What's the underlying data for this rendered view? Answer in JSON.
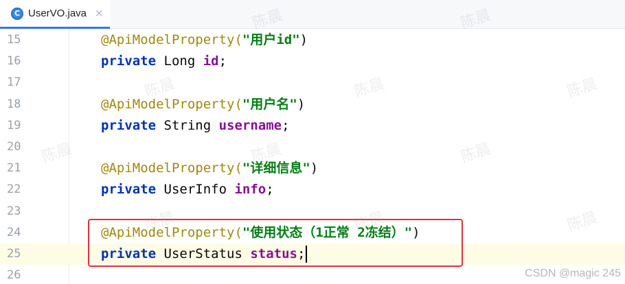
{
  "tab": {
    "icon_letter": "C",
    "icon": "java-class-icon",
    "filename": "UserVO.java",
    "close_glyph": "×"
  },
  "lines": [
    {
      "number": "15",
      "tokens": [
        {
          "t": "annotation",
          "v": "@ApiModelProperty("
        },
        {
          "t": "string",
          "v": "\"用户id\""
        },
        {
          "t": "plain",
          "v": ")"
        }
      ]
    },
    {
      "number": "16",
      "tokens": [
        {
          "t": "keyword",
          "v": "private"
        },
        {
          "t": "plain",
          "v": " Long "
        },
        {
          "t": "field",
          "v": "id"
        },
        {
          "t": "plain",
          "v": ";"
        }
      ]
    },
    {
      "number": "17",
      "tokens": []
    },
    {
      "number": "18",
      "tokens": [
        {
          "t": "annotation",
          "v": "@ApiModelProperty("
        },
        {
          "t": "string",
          "v": "\"用户名\""
        },
        {
          "t": "plain",
          "v": ")"
        }
      ]
    },
    {
      "number": "19",
      "tokens": [
        {
          "t": "keyword",
          "v": "private"
        },
        {
          "t": "plain",
          "v": " String "
        },
        {
          "t": "field",
          "v": "username"
        },
        {
          "t": "plain",
          "v": ";"
        }
      ]
    },
    {
      "number": "20",
      "tokens": []
    },
    {
      "number": "21",
      "tokens": [
        {
          "t": "annotation",
          "v": "@ApiModelProperty("
        },
        {
          "t": "string",
          "v": "\"详细信息\""
        },
        {
          "t": "plain",
          "v": ")"
        }
      ]
    },
    {
      "number": "22",
      "tokens": [
        {
          "t": "keyword",
          "v": "private"
        },
        {
          "t": "plain",
          "v": " UserInfo "
        },
        {
          "t": "field",
          "v": "info"
        },
        {
          "t": "plain",
          "v": ";"
        }
      ]
    },
    {
      "number": "23",
      "tokens": []
    },
    {
      "number": "24",
      "tokens": [
        {
          "t": "annotation",
          "v": "@ApiModelProperty("
        },
        {
          "t": "string",
          "v": "\"使用状态（1正常 2冻结）\""
        },
        {
          "t": "plain",
          "v": ")"
        }
      ]
    },
    {
      "number": "25",
      "tokens": [
        {
          "t": "keyword",
          "v": "private"
        },
        {
          "t": "plain",
          "v": " UserStatus "
        },
        {
          "t": "field",
          "v": "status"
        },
        {
          "t": "plain",
          "v": ";"
        }
      ],
      "current": true,
      "caret": true
    },
    {
      "number": "26",
      "tokens": []
    }
  ],
  "watermark_text": "陈晨",
  "credit": "CSDN @magic 245",
  "colors": {
    "annotation": "#9e880d",
    "string": "#067d17",
    "keyword": "#0033b3",
    "field": "#871094",
    "highlight_border": "#e0303d",
    "current_line": "#fefce5"
  }
}
